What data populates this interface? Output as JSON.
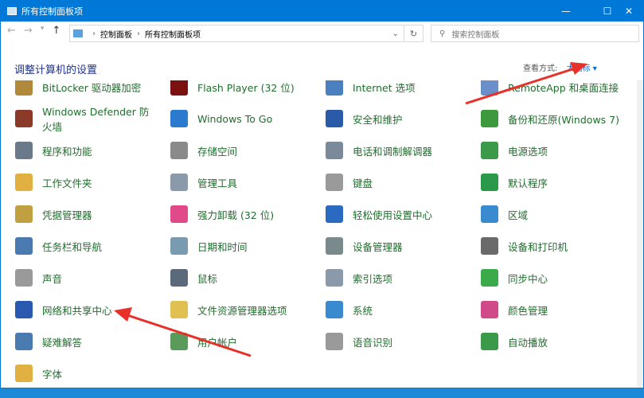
{
  "window": {
    "title": "所有控制面板项",
    "minimize": "—",
    "maximize": "☐",
    "close": "✕"
  },
  "nav": {
    "back": "←",
    "forward": "→",
    "recent": "▾",
    "up": "↑"
  },
  "address": {
    "crumbs": [
      "控制面板",
      "所有控制面板项"
    ],
    "separator": "›",
    "dropdown": "⌄",
    "refresh": "↻"
  },
  "search": {
    "icon": "⚲",
    "placeholder": "搜索控制面板"
  },
  "heading": "调整计算机的设置",
  "view_by": {
    "label": "查看方式:",
    "value": "大图标 ▾"
  },
  "items": [
    {
      "label": "BitLocker 驱动器加密",
      "color": "#b08a3a"
    },
    {
      "label": "Flash Player (32 位)",
      "color": "#7a1010"
    },
    {
      "label": "Internet 选项",
      "color": "#4a7fc0"
    },
    {
      "label": "RemoteApp 和桌面连接",
      "color": "#6a8fc9"
    },
    {
      "label": "Windows Defender 防火墙",
      "color": "#8b3a2a"
    },
    {
      "label": "Windows To Go",
      "color": "#2a7ad0"
    },
    {
      "label": "安全和维护",
      "color": "#2a5aa8"
    },
    {
      "label": "备份和还原(Windows 7)",
      "color": "#3c9a3c"
    },
    {
      "label": "程序和功能",
      "color": "#6a7a8a"
    },
    {
      "label": "存储空间",
      "color": "#8a8a8a"
    },
    {
      "label": "电话和调制解调器",
      "color": "#7a8a9a"
    },
    {
      "label": "电源选项",
      "color": "#3a9a4a"
    },
    {
      "label": "工作文件夹",
      "color": "#e0b040"
    },
    {
      "label": "管理工具",
      "color": "#8a9aaa"
    },
    {
      "label": "键盘",
      "color": "#9a9a9a"
    },
    {
      "label": "默认程序",
      "color": "#2a9a4a"
    },
    {
      "label": "凭据管理器",
      "color": "#c0a040"
    },
    {
      "label": "强力卸载 (32 位)",
      "color": "#e04a8a"
    },
    {
      "label": "轻松使用设置中心",
      "color": "#2a6ac0"
    },
    {
      "label": "区域",
      "color": "#3a8ad0"
    },
    {
      "label": "任务栏和导航",
      "color": "#4a7ab0"
    },
    {
      "label": "日期和时间",
      "color": "#7a9ab0"
    },
    {
      "label": "设备管理器",
      "color": "#7a8a8a"
    },
    {
      "label": "设备和打印机",
      "color": "#6a6a6a"
    },
    {
      "label": "声音",
      "color": "#9a9a9a"
    },
    {
      "label": "鼠标",
      "color": "#5a6a7a"
    },
    {
      "label": "索引选项",
      "color": "#8a9aaa"
    },
    {
      "label": "同步中心",
      "color": "#3aaa4a"
    },
    {
      "label": "网络和共享中心",
      "color": "#2a5ab0"
    },
    {
      "label": "文件资源管理器选项",
      "color": "#e0c050"
    },
    {
      "label": "系统",
      "color": "#3a8ad0"
    },
    {
      "label": "颜色管理",
      "color": "#d04a8a"
    },
    {
      "label": "疑难解答",
      "color": "#4a7ab0"
    },
    {
      "label": "用户帐户",
      "color": "#5a9a5a"
    },
    {
      "label": "语音识别",
      "color": "#9a9a9a"
    },
    {
      "label": "自动播放",
      "color": "#3a9a4a"
    },
    {
      "label": "字体",
      "color": "#e0b040"
    }
  ],
  "colors": {
    "titlebar": "#0078d7",
    "item_text": "#1f6e2c",
    "heading": "#1e3287",
    "link": "#0066cc",
    "arrow": "#e8302a"
  }
}
